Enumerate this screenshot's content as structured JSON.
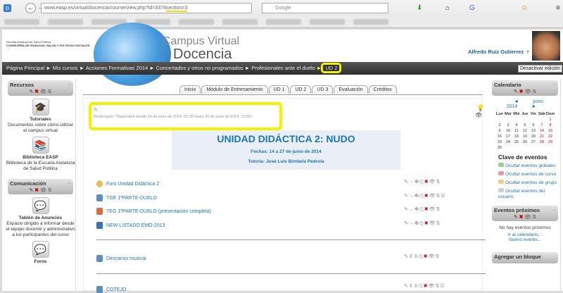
{
  "browser": {
    "url_prefix": "www.easp.es/virtual/docencia/course/view.php?id=3378",
    "url_highlight": "section=3",
    "search_placeholder": "Google"
  },
  "header": {
    "logo_line1": "Escuela Andaluza de Salud Pública",
    "logo_line2": "CONSEJERÍA DE IGUALDAD, SALUD Y POLÍTICAS SOCIALES",
    "title1": "Campus Virtual",
    "title2": "Docencia",
    "user": "Alfredo Ruiz Gutierrez"
  },
  "breadcrumb": [
    "Página Principal",
    "Mis cursos",
    "Acciones Formativas 2014",
    "Concertados y otros no programados",
    "Profesionales ante el duelo",
    "UD 2"
  ],
  "edit_button": "Desactivar edición",
  "left": {
    "recursos": "Recursos",
    "items": [
      {
        "title": "Tutoriales",
        "desc": "Documentos sobre cómo utilizar el campus virtual"
      },
      {
        "title": "Biblioteca EASP",
        "desc": "Biblioteca de la Escuela Andaluza de Salud Pública"
      }
    ],
    "comunicacion": "Comunicación",
    "comm_items": [
      {
        "title": "Tablón de Anuncios",
        "desc": "Espacio dirigido a informar desde el equipo docente y administrativo a los participantes del curso"
      },
      {
        "title": "Foros"
      }
    ]
  },
  "tabs": [
    "Inicio",
    "Módulo de Entrenamiento",
    "UD 1",
    "UD 2",
    "UD 3",
    "Evaluación",
    "Créditos"
  ],
  "section": {
    "restriction": "Restringido: \"Disponible desde 14 de junio de 2014, 01:00 hasta 30 de junio de 2014, 23:55.\"",
    "title": "UNIDAD DIDÁCTICA 2: NUDO",
    "dates": "Fechas: 14 a 27 de junio de 2014",
    "tutor": "Tutoría: José Luis Bimbela Pedrola",
    "activities": [
      "Foro Unidad Didáctica 2",
      "TGE 1ªPARTE-DUELO",
      "TEG 1ªPARTE-DUELO (presentación completa)",
      "NEW LISTADO EMO-2013"
    ],
    "descanso": "Descanso musical",
    "cotejo": "COTEJO"
  },
  "calendar": {
    "title": "Calendario",
    "month": "junio 2014",
    "days": [
      "Lun",
      "Mar",
      "Mié",
      "Jue",
      "Vie",
      "Sáb",
      "Dom"
    ],
    "weeks": [
      [
        "",
        "",
        "",
        "",
        "",
        "",
        "1"
      ],
      [
        "2",
        "3",
        "4",
        "5",
        "6",
        "7",
        "8"
      ],
      [
        "9",
        "10",
        "11",
        "12",
        "13",
        "14",
        "15"
      ],
      [
        "16",
        "17",
        "18",
        "19",
        "20",
        "21",
        "22"
      ],
      [
        "23",
        "24",
        "25",
        "26",
        "27",
        "28",
        "29"
      ],
      [
        "30",
        "",
        "",
        "",
        "",
        "",
        ""
      ]
    ],
    "clave": "Clave de eventos",
    "events": [
      "Ocultar eventos globales",
      "Ocultar eventos de curso",
      "Ocultar eventos de grupo",
      "Ocultar eventos del usuario"
    ]
  },
  "proximos": {
    "title": "Eventos próximos",
    "none": "No hay eventos próximos",
    "link1": "Ir al calendario...",
    "link2": "Nuevo evento..."
  },
  "agregar": "Agregar un bloque"
}
